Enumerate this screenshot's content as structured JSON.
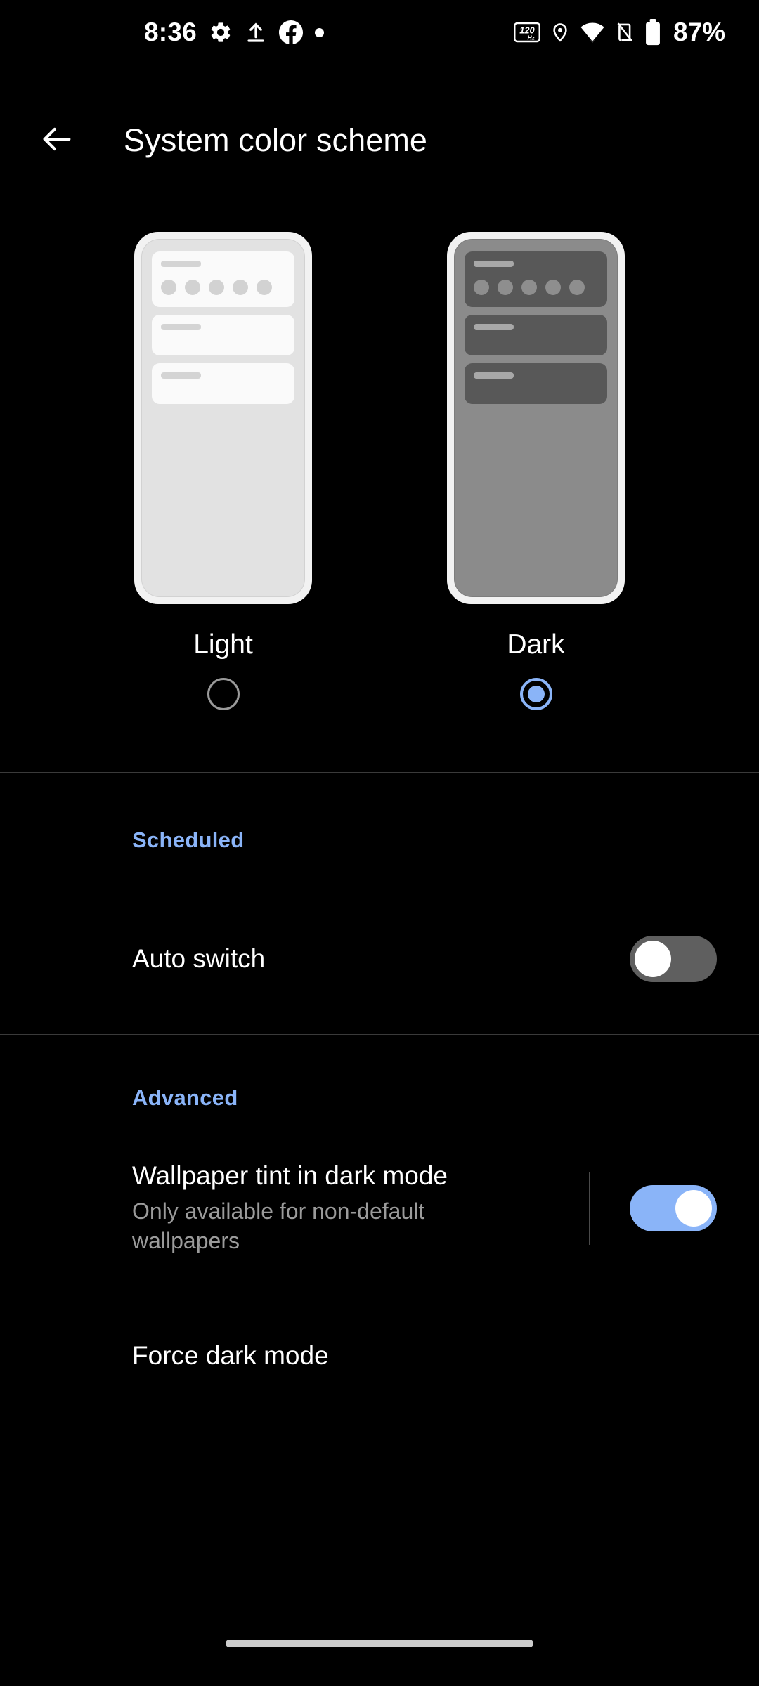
{
  "status_bar": {
    "time": "8:36",
    "battery_percent": "87%",
    "left_icons": [
      "gear-icon",
      "upload-icon",
      "facebook-icon",
      "dot-icon"
    ],
    "right_icons": [
      "refresh-rate-120hz-icon",
      "location-icon",
      "wifi-icon",
      "vibrate-off-icon",
      "battery-icon"
    ],
    "refresh_rate_label": "120",
    "refresh_rate_unit": "Hz"
  },
  "app_bar": {
    "back_icon": "back-arrow-icon",
    "title": "System color scheme"
  },
  "theme_chooser": {
    "options": [
      {
        "label": "Light",
        "selected": false,
        "variant": "light"
      },
      {
        "label": "Dark",
        "selected": true,
        "variant": "dark"
      }
    ]
  },
  "sections": [
    {
      "title": "Scheduled",
      "rows": [
        {
          "title": "Auto switch",
          "subtitle": "",
          "toggle": "off",
          "has_divider": false
        }
      ]
    },
    {
      "title": "Advanced",
      "rows": [
        {
          "title": "Wallpaper tint in dark mode",
          "subtitle": "Only available for non-default wallpapers",
          "toggle": "on",
          "has_divider": true
        },
        {
          "title": "Force dark mode",
          "subtitle": "",
          "toggle": "none",
          "has_divider": false
        }
      ]
    }
  ],
  "colors": {
    "background": "#000000",
    "accent_blue": "#8ab4f8",
    "primary_text": "#ffffff",
    "secondary_text": "#9b9b9b",
    "divider": "#3a3a3a",
    "toggle_off_track": "#5f5f5f",
    "light_preview_body": "#e2e2e2",
    "dark_preview_body": "#8b8b8b",
    "dark_preview_card": "#585858"
  },
  "nav_bar": {
    "gesture_pill": "home-gesture-pill"
  }
}
